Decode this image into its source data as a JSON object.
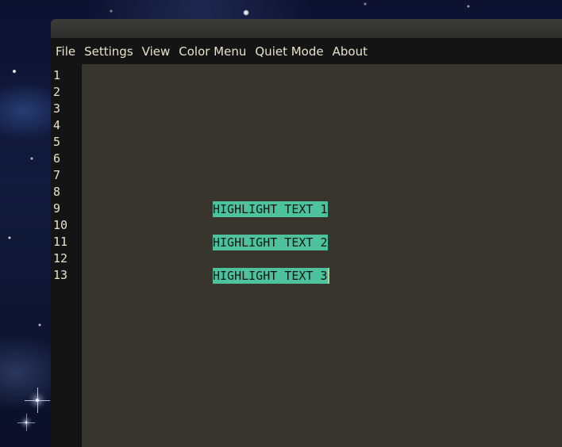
{
  "menu": {
    "items": [
      "File",
      "Settings",
      "View",
      "Color Menu",
      "Quiet Mode",
      "About"
    ]
  },
  "editor": {
    "line_numbers": [
      "1",
      "2",
      "3",
      "4",
      "5",
      "6",
      "7",
      "8",
      "9",
      "10",
      "11",
      "12",
      "13"
    ],
    "lines": {
      "9": "HIGHLIGHT TEXT 1",
      "11": "HIGHLIGHT TEXT 2",
      "13": "HIGHLIGHT TEXT 3"
    }
  },
  "colors": {
    "editor_background": "#38342e",
    "gutter_background": "#141414",
    "menubar_background": "#141414",
    "text": "#e8e2cc",
    "highlight": "#4ec29c",
    "highlight_text": "#141414"
  }
}
